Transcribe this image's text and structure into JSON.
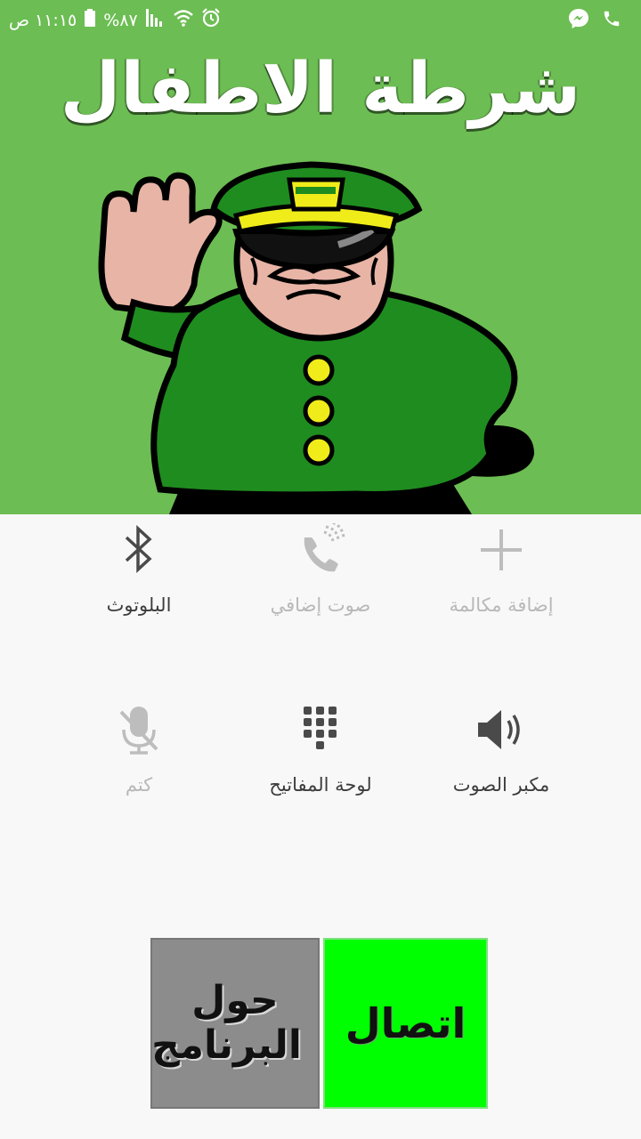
{
  "status_bar": {
    "time": "١١:١٥ ص",
    "battery": "%٨٧",
    "icons": [
      "messenger-icon",
      "phone-icon",
      "battery-icon",
      "signal-icon",
      "wifi-icon",
      "alarm-icon"
    ]
  },
  "hero": {
    "title": "شرطة الاطفال",
    "background": "#6cbd53"
  },
  "actions": [
    {
      "label": "إضافة مكالمة",
      "icon": "plus-icon",
      "enabled": false
    },
    {
      "label": "صوت إضافي",
      "icon": "extra-volume-icon",
      "enabled": false
    },
    {
      "label": "البلوتوث",
      "icon": "bluetooth-icon",
      "enabled": true
    },
    {
      "label": "مكبر الصوت",
      "icon": "speaker-icon",
      "enabled": true
    },
    {
      "label": "لوحة المفاتيح",
      "icon": "keypad-icon",
      "enabled": true
    },
    {
      "label": "كتم",
      "icon": "mute-mic-icon",
      "enabled": false
    }
  ],
  "buttons": {
    "about": "حول البرنامج",
    "call": "اتصال",
    "about_color": "#8c8c8c",
    "call_color": "#00ff00"
  }
}
